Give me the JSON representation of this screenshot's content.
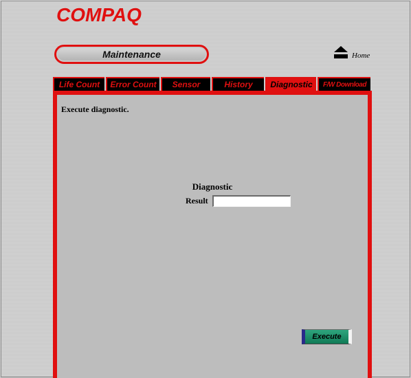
{
  "header": {
    "logo_text": "COMPAQ",
    "section_title": "Maintenance",
    "home_label": "Home"
  },
  "tabs": [
    {
      "label": "Life Count",
      "active": false
    },
    {
      "label": "Error Count",
      "active": false
    },
    {
      "label": "Sensor",
      "active": false
    },
    {
      "label": "History",
      "active": false
    },
    {
      "label": "Diagnostic",
      "active": true
    },
    {
      "label": "F/W Download",
      "active": false
    }
  ],
  "panel": {
    "description": "Execute diagnostic.",
    "title": "Diagnostic",
    "result_label": "Result",
    "result_value": "",
    "execute_label": "Execute"
  },
  "colors": {
    "accent": "#e01010",
    "tab_bg": "#000000",
    "panel_bg": "#bdbdbd",
    "button_bg": "#1a8e66"
  },
  "icons": {
    "home": "eject-home-icon"
  }
}
